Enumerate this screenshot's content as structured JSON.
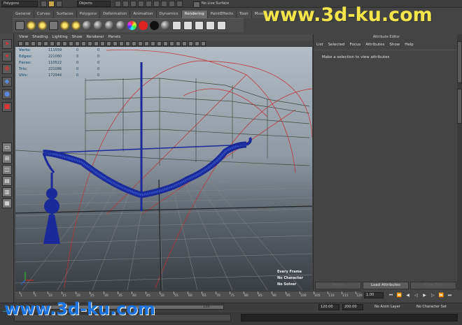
{
  "status_line": {
    "mode": "Polygons",
    "selection_mask": "Objects",
    "live_surface": "No Live Surface"
  },
  "shelf": {
    "tabs": [
      "General",
      "Curves",
      "Surfaces",
      "Polygons",
      "Deformation",
      "Animation",
      "Dynamics",
      "Rendering",
      "PaintEffects",
      "Toon",
      "Muscle"
    ],
    "active_tab": "Rendering"
  },
  "viewport": {
    "menu": [
      "View",
      "Shading",
      "Lighting",
      "Show",
      "Renderer",
      "Panels"
    ],
    "hud": [
      {
        "label": "Verts:",
        "values": [
          "111559",
          "0",
          "0"
        ]
      },
      {
        "label": "Edges:",
        "values": [
          "221080",
          "0",
          "0"
        ]
      },
      {
        "label": "Faces:",
        "values": [
          "110522",
          "0",
          "0"
        ]
      },
      {
        "label": "Tris:",
        "values": [
          "221086",
          "0",
          "0"
        ]
      },
      {
        "label": "UVs:",
        "values": [
          "172944",
          "0",
          "0"
        ]
      }
    ],
    "hud_bottom_right": [
      "Every Frame",
      "No Character",
      "No Solver"
    ]
  },
  "attribute_editor": {
    "title": "Attribute Editor",
    "menu": [
      "List",
      "Selected",
      "Focus",
      "Attributes",
      "Show",
      "Help"
    ],
    "message": "Make a selection to view attributes",
    "buttons": [
      "Select",
      "Load Attributes",
      "Copy Tab"
    ]
  },
  "time_slider": {
    "ticks": [
      "1",
      "5",
      "10",
      "15",
      "20",
      "25",
      "30",
      "35",
      "40",
      "45",
      "50",
      "55",
      "60",
      "65",
      "70",
      "75",
      "80",
      "85",
      "90",
      "95",
      "100",
      "105",
      "110",
      "115",
      "120"
    ],
    "current_frame": "1.00"
  },
  "range_slider": {
    "range_end_label": "120",
    "start": "120.00",
    "end": "200.00",
    "anim_layer": "No Anim Layer",
    "character_set": "No Character Set"
  },
  "watermark": "www.3d-ku.com"
}
